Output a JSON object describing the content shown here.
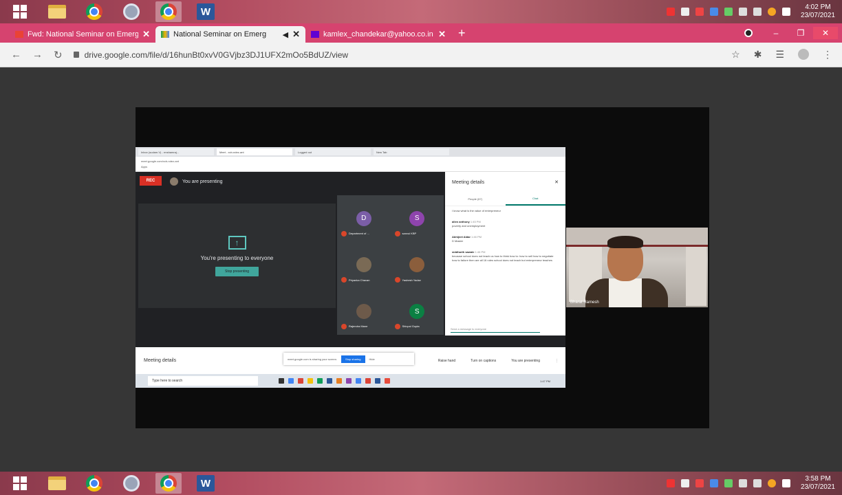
{
  "taskbar_top": {
    "time": "4:02 PM",
    "date": "23/07/2021"
  },
  "taskbar_bottom": {
    "time": "3:58 PM",
    "date": "23/07/2021"
  },
  "browser": {
    "tabs": [
      {
        "title": "Fwd: National Seminar on Emerg",
        "favicon": "gmail-icon"
      },
      {
        "title": "National Seminar on Emerg",
        "favicon": "drive-icon",
        "active": true
      },
      {
        "title": "kamlex_chandekar@yahoo.co.in",
        "favicon": "yahoo-mail-icon"
      }
    ],
    "url": "drive.google.com/file/d/16hunBt0xvV0GVjbz3DJ1UFX2mOo5BdUZ/view"
  },
  "meet": {
    "rec_label": "REC",
    "presenting_header": "You are presenting",
    "presenting_message": "You're presenting to everyone",
    "stop_presenting": "Stop presenting",
    "participants": [
      {
        "initial": "D",
        "name": "Department of ...",
        "color": "#7b5ea7"
      },
      {
        "initial": "S",
        "name": "sanvui KBP",
        "color": "#8e44ad"
      },
      {
        "initial": "",
        "name": "Priyanka Chavan",
        "color": "#7a6a55"
      },
      {
        "initial": "",
        "name": "Yashesh Yadav",
        "color": "#8b5e3c"
      },
      {
        "initial": "",
        "name": "Rajendra Mane",
        "color": "#6d5a4a"
      },
      {
        "initial": "S",
        "name": "Shivpal Gupta",
        "color": "#0b8043"
      }
    ],
    "details": {
      "title": "Meeting details",
      "tab_people": "People (67)",
      "tab_chat": "Chat",
      "messages": [
        {
          "who": "",
          "time": "",
          "text": "I know what is the value of enterpreneur"
        },
        {
          "who": "allen anthony",
          "time": "1:45 PM",
          "text": "poverty and unemployment"
        },
        {
          "who": "Abhijeet Aldar",
          "time": "1:46 PM",
          "text": "D Master"
        },
        {
          "who": "siddharth sawale",
          "time": "1:46 PM",
          "text": "because school does not teach us how to think how to: how to sell how to negotiate how to failure then are all 16 rules school does not teach but enterpreneur teaches"
        }
      ],
      "input_placeholder": "Send a message to everyone"
    },
    "bottom_bar": {
      "meeting_details": "Meeting details",
      "share_toast": "meet.google.com is sharing your screen.",
      "stop_sharing": "Stop sharing",
      "hide": "Hide",
      "raise_hand": "Raise hand",
      "captions": "Turn on captions",
      "presenting": "You are presenting"
    },
    "inner_taskbar": {
      "search_placeholder": "Type here to search",
      "time": "1:47 PM"
    },
    "inner_tabs": [
      "Inbox (sudam.V) - rmshamraj...",
      "Meet - xcb-ndez-ant",
      "Logged out",
      "New Tab"
    ],
    "inner_url": "meet.google.com/xcb-ndez-ant",
    "inner_apps": "Apps"
  },
  "speaker": {
    "name": "Bharat Ramesh"
  }
}
